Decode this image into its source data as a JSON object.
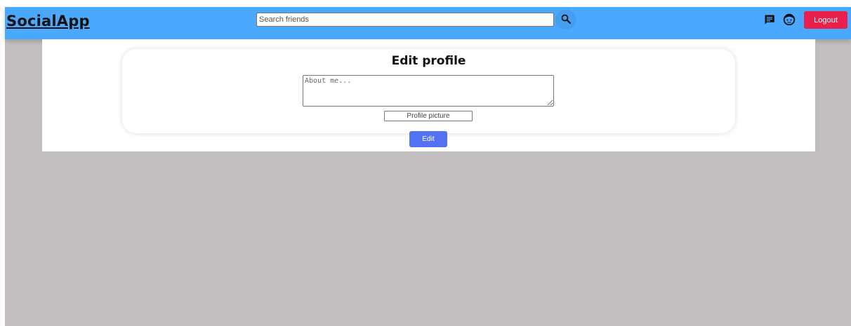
{
  "navbar": {
    "brand": "SocialApp",
    "search": {
      "placeholder": "Search friends",
      "value": ""
    },
    "search_icon": "search-icon",
    "messages_icon": "chat-icon",
    "profile_icon": "avatar-face-icon",
    "logout_label": "Logout",
    "colors": {
      "background": "#4aa8ff",
      "logout": "#e8204a"
    }
  },
  "edit_profile": {
    "title": "Edit profile",
    "about": {
      "placeholder": "About me...",
      "value": ""
    },
    "picture_label": "Profile picture",
    "submit_label": "Edit",
    "colors": {
      "submit": "#5272f2"
    }
  }
}
